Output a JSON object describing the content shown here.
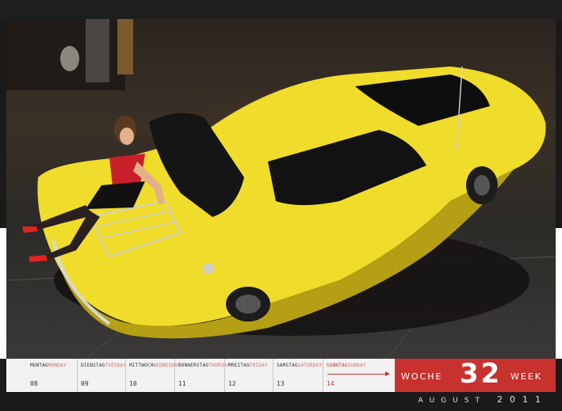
{
  "calendar": {
    "days": [
      {
        "de": "MONTAG",
        "en": "MONDAY",
        "date": "08"
      },
      {
        "de": "DIENSTAG",
        "en": "TUESDAY",
        "date": "09"
      },
      {
        "de": "MITTWOCH",
        "en": "WEDNESDAY",
        "date": "10"
      },
      {
        "de": "DONNERSTAG",
        "en": "THURSDAY",
        "date": "11"
      },
      {
        "de": "FREITAG",
        "en": "FRIDAY",
        "date": "12"
      },
      {
        "de": "SAMSTAG",
        "en": "SATURDAY",
        "date": "13"
      },
      {
        "de": "SONNTAG",
        "en": "SUNDAY",
        "date": "14"
      }
    ]
  },
  "week": {
    "label_de": "WOCHE",
    "number": "32",
    "label_en": "WEEK"
  },
  "footer": {
    "month": "AUGUST",
    "year": "2011"
  },
  "colors": {
    "accent": "#c8322e",
    "car": "#f0dc2a"
  }
}
